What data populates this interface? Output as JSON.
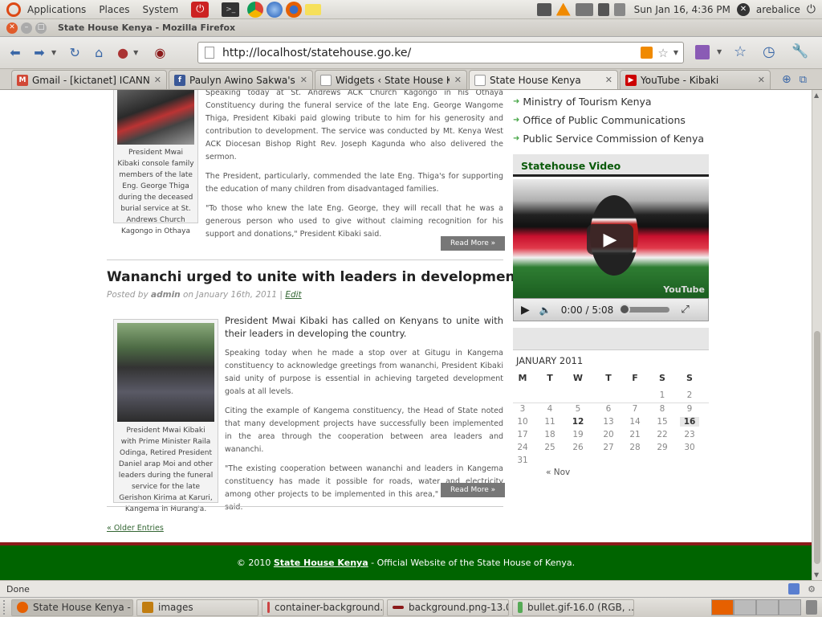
{
  "gnome_panel": {
    "menus": [
      "Applications",
      "Places",
      "System"
    ],
    "clock": "Sun Jan 16,  4:36 PM",
    "user": "arebalice"
  },
  "window": {
    "title": "State House Kenya - Mozilla Firefox"
  },
  "navbar": {
    "url": "http://localhost/statehouse.go.ke/"
  },
  "tabs": [
    {
      "label": "Gmail - [kictanet] ICANN ...",
      "icon": "gmail-icon",
      "color": "#d14836",
      "active": false
    },
    {
      "label": "Paulyn Awino Sakwa's Ph...",
      "icon": "facebook-icon",
      "color": "#3b5998",
      "active": false
    },
    {
      "label": "Widgets ‹ State House Ke...",
      "icon": "page-icon",
      "color": "#999999",
      "active": false
    },
    {
      "label": "State House Kenya",
      "icon": "page-icon",
      "color": "#999999",
      "active": true
    },
    {
      "label": "YouTube - Kibaki",
      "icon": "youtube-icon",
      "color": "#cc0000",
      "active": false
    }
  ],
  "post1": {
    "caption": "President Mwai Kibaki console family members of the late Eng. George Thiga during the deceased burial service at St. Andrews Church Kagongo in Othaya",
    "paragraphs": [
      "Speaking today at St. Andrews ACK Church Kagongo in his Othaya Constituency during the funeral service of the late Eng. George Wangome Thiga, President Kibaki paid glowing tribute to him for his generosity and contribution to development. The service was conducted by Mt. Kenya West ACK Diocesan Bishop Right Rev. Joseph Kagunda who also delivered the sermon.",
      "The President, particularly, commended the late Eng. Thiga's for supporting the education of many children from disadvantaged families.",
      "\"To those who knew the late Eng. George, they will recall that he was a generous person who used to give without claiming recognition for his support and donations,\" President Kibaki said."
    ],
    "read_more": "Read More »"
  },
  "post2": {
    "title": "Wananchi urged to unite with leaders in development.",
    "meta_prefix": "Posted by",
    "author": "admin",
    "meta_on": "on January 16th, 2011 |",
    "edit": "Edit",
    "lead": "President Mwai Kibaki has called on Kenyans to unite with their leaders in developing the country.",
    "paragraphs": [
      "Speaking today when he made a stop over at Gitugu in Kangema constituency to acknowledge greetings from wananchi, President Kibaki said unity of purpose is essential in achieving targeted development goals at all levels.",
      "Citing the example of Kangema constituency, the Head of State noted that many development projects have successfully been implemented in the area through the cooperation between area leaders and wananchi.",
      "\"The existing cooperation between wananchi and leaders in Kangema constituency has made it possible for roads, water and electricity among other projects to be implemented in this area,\" President Kibaki said."
    ],
    "caption": "President Mwai Kibaki with Prime Minister Raila Odinga, Retired President Daniel arap Moi and other leaders during the funeral service for the late Gerishon Kirima at Karuri, Kangema in Murang'a.",
    "read_more": "Read More »"
  },
  "older_entries": "« Older Entries",
  "sidebar": {
    "links": [
      "Ministry of Tourism Kenya",
      "Office of Public Communications",
      "Public Service Commission of Kenya"
    ],
    "video_title": "Statehouse Video",
    "video_time": "0:00 / 5:08",
    "video_watermark": "YouTube"
  },
  "calendar": {
    "month": "JANUARY 2011",
    "weekdays": [
      "M",
      "T",
      "W",
      "T",
      "F",
      "S",
      "S"
    ],
    "weeks": [
      [
        "",
        "",
        "",
        "",
        "",
        "1",
        "2"
      ],
      [
        "3",
        "4",
        "5",
        "6",
        "7",
        "8",
        "9"
      ],
      [
        "10",
        "11",
        "12",
        "13",
        "14",
        "15",
        "16"
      ],
      [
        "17",
        "18",
        "19",
        "20",
        "21",
        "22",
        "23"
      ],
      [
        "24",
        "25",
        "26",
        "27",
        "28",
        "29",
        "30"
      ],
      [
        "31",
        "",
        "",
        "",
        "",
        "",
        ""
      ]
    ],
    "linked_days": [
      "12"
    ],
    "today": "16",
    "prev": "« Nov"
  },
  "footer": {
    "prefix": "© 2010",
    "site": "State House Kenya",
    "suffix": "- Official Website of the State House of Kenya."
  },
  "status": "Done",
  "taskbar": [
    {
      "label": "State House Kenya - ...",
      "icon": "firefox-icon",
      "color": "#e66000",
      "active": true
    },
    {
      "label": "images",
      "icon": "folder-icon",
      "color": "#c17d11",
      "active": false
    },
    {
      "label": "container-background....",
      "icon": "image-icon",
      "color": "#cc4444",
      "active": false
    },
    {
      "label": "background.png-13.0 ...",
      "icon": "image-icon",
      "color": "#8b1a1a",
      "active": false
    },
    {
      "label": "bullet.gif-16.0 (RGB, ...",
      "icon": "image-icon",
      "color": "#55aa55",
      "active": false
    }
  ]
}
